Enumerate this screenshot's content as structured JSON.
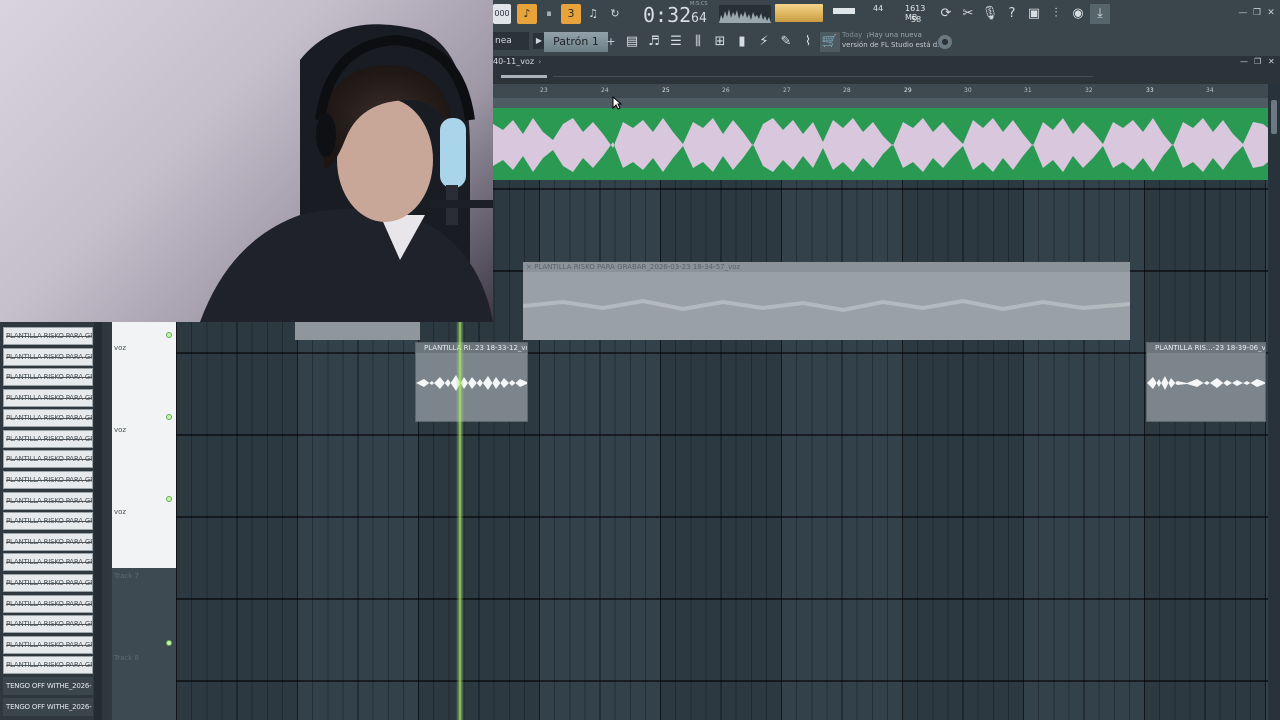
{
  "toolbar": {
    "time": "0:32",
    "time_ms": "64",
    "time_unit": "M:S:CS",
    "cpu": "44",
    "memory": "1613 MB",
    "polyphony": "58",
    "tempo_partial": "000",
    "mode_field": "nea",
    "pattern": "Patrón 1",
    "pattern_add": "+",
    "hint_today": "Today",
    "hint_line1": "¡Hay una nueva",
    "hint_line2": "versión de FL Studio está d.",
    "accent_color": "#e8a33a"
  },
  "playlist": {
    "title": "40-11_voz",
    "title_arrow": "›",
    "ruler_ticks": [
      "23",
      "24",
      "25",
      "26",
      "27",
      "28",
      "29",
      "30",
      "31",
      "32",
      "33",
      "34"
    ]
  },
  "clips": {
    "grey_clip_label": "× PLANTILLA RISKO PARA GRABAR_2026-03-23 18-34-57_voz",
    "clip_a_label": "PLANTILLA RI..23 18-33-12_voz",
    "clip_b_label": "PLANTILLA RIS...-23 18-39-06_voz",
    "green_color": "#2a9a52",
    "waveform_color": "#d9c7de"
  },
  "tracks": [
    {
      "name": "voz"
    },
    {
      "name": "voz"
    },
    {
      "name": "voz"
    },
    {
      "name": "Track 7"
    },
    {
      "name": "Track 8"
    }
  ],
  "picker": {
    "items": [
      "PLANTILLA RISKO PARA GR...",
      "PLANTILLA RISKO PARA GR...",
      "PLANTILLA RISKO PARA GR...",
      "PLANTILLA RISKO PARA GR...",
      "PLANTILLA RISKO PARA GR...",
      "PLANTILLA RISKO PARA GR...",
      "PLANTILLA RISKO PARA GR...",
      "PLANTILLA RISKO PARA GR...",
      "PLANTILLA RISKO PARA GR...",
      "PLANTILLA RISKO PARA GR...",
      "PLANTILLA RISKO PARA GR...",
      "PLANTILLA RISKO PARA GR...",
      "PLANTILLA RISKO PARA GR...",
      "PLANTILLA RISKO PARA GR...",
      "PLANTILLA RISKO PARA GR...",
      "PLANTILLA RISKO PARA GR...",
      "PLANTILLA RISKO PARA GR..."
    ],
    "plain_items": [
      "TENGO OFF WITHE_2026-...",
      "TENGO OFF WITHE_2026-..."
    ]
  }
}
